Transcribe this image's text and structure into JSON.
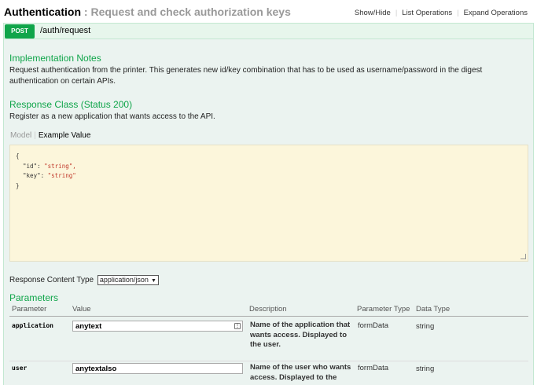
{
  "resource": {
    "name": "Authentication",
    "separator": ":",
    "description": "Request and check authorization keys",
    "ops": [
      "Show/Hide",
      "List Operations",
      "Expand Operations"
    ]
  },
  "operation": {
    "method": "POST",
    "path": "/auth/request"
  },
  "implementation_notes": {
    "heading": "Implementation Notes",
    "text": "Request authentication from the printer. This generates new id/key combination that has to be used as username/password in the digest authentication on certain APIs."
  },
  "response_class": {
    "heading": "Response Class (Status 200)",
    "text": "Register as a new application that wants access to the API."
  },
  "tabs": {
    "model": "Model",
    "example": "Example Value"
  },
  "example_json": {
    "lines": [
      "{",
      "  \"id\": ",
      "  \"key\": ",
      "}"
    ],
    "id_value": "\"string\",",
    "key_value": "\"string\""
  },
  "response_content_type": {
    "label": "Response Content Type",
    "selected": "application/json"
  },
  "parameters": {
    "heading": "Parameters",
    "columns": [
      "Parameter",
      "Value",
      "Description",
      "Parameter Type",
      "Data Type"
    ],
    "rows": [
      {
        "name": "application",
        "value": "anytext",
        "description": "Name of the application that wants access. Displayed to the user.",
        "param_type": "formData",
        "data_type": "string"
      },
      {
        "name": "user",
        "value": "anytextalso",
        "description": "Name of the user who wants access. Displayed to the user",
        "param_type": "formData",
        "data_type": "string"
      }
    ]
  }
}
